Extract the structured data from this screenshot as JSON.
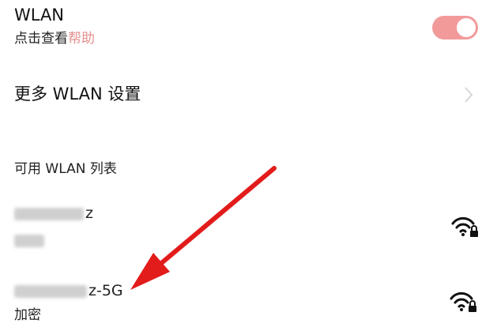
{
  "wlan": {
    "title": "WLAN",
    "subtitle_prefix": "点击查看",
    "help_link": "帮助",
    "enabled": true
  },
  "more_settings": {
    "label": "更多 WLAN 设置"
  },
  "section": {
    "header": "可用 WLAN 列表"
  },
  "networks": [
    {
      "name_visible": "z",
      "security": "加密",
      "signal_icon": "wifi-lock-icon"
    },
    {
      "name_visible": "z-5G",
      "security": "加密",
      "signal_icon": "wifi-lock-icon"
    }
  ],
  "annotation": {
    "type": "red-arrow",
    "color": "#e21b1b"
  }
}
